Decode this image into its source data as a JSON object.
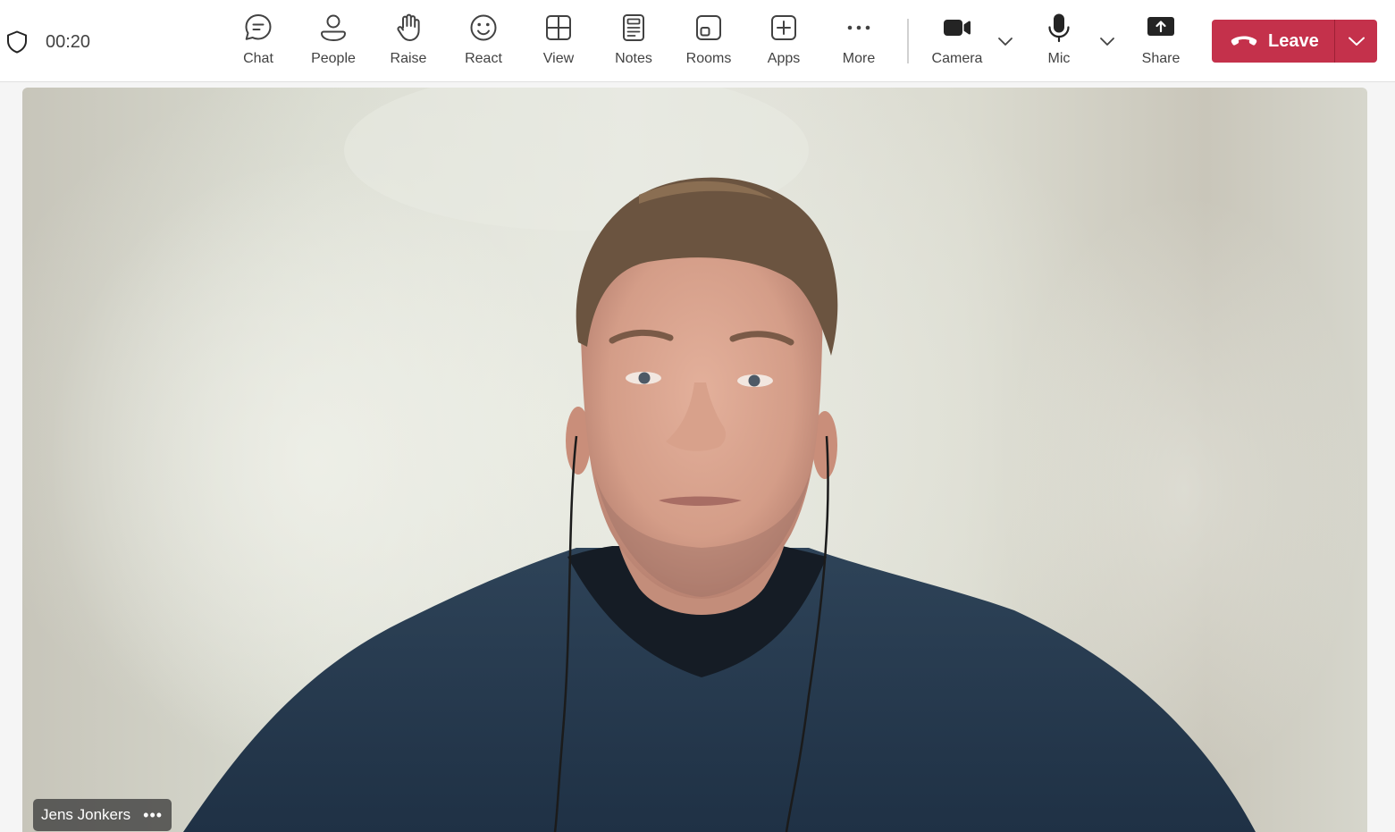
{
  "meeting": {
    "timer": "00:20"
  },
  "toolbar": {
    "chat": "Chat",
    "people": "People",
    "raise": "Raise",
    "react": "React",
    "view": "View",
    "notes": "Notes",
    "rooms": "Rooms",
    "apps": "Apps",
    "more": "More",
    "camera": "Camera",
    "mic": "Mic",
    "share": "Share",
    "leave": "Leave"
  },
  "icons": {
    "shield": "shield-icon",
    "chat": "chat-bubble-icon",
    "people": "person-icon",
    "raise": "raise-hand-icon",
    "react": "smiley-icon",
    "view": "grid-view-icon",
    "notes": "notes-icon",
    "rooms": "rooms-icon",
    "apps": "apps-plus-icon",
    "more": "ellipsis-icon",
    "camera": "video-camera-icon",
    "mic": "microphone-icon",
    "share": "share-screen-icon",
    "leave": "phone-hangup-icon"
  },
  "colors": {
    "leave_button": "#c4314b",
    "toolbar_background": "#ffffff",
    "page_background": "#f5f5f5"
  },
  "participant": {
    "name": "Jens Jonkers",
    "more_label": "•••"
  }
}
